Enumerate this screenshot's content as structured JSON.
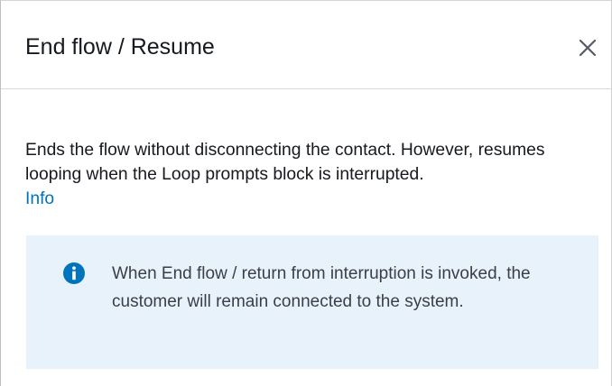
{
  "dialog": {
    "title": "End flow / Resume",
    "close_icon": "close-icon"
  },
  "body": {
    "description": "Ends the flow without disconnecting the contact. However, resumes looping when the Loop prompts block is interrupted.",
    "info_link": "Info"
  },
  "alert": {
    "icon": "info-circle-icon",
    "text": "When End flow / return from interruption is invoked, the customer will remain connected to the system.",
    "icon_color": "#0073bb",
    "background_color": "#e7f2fb"
  }
}
